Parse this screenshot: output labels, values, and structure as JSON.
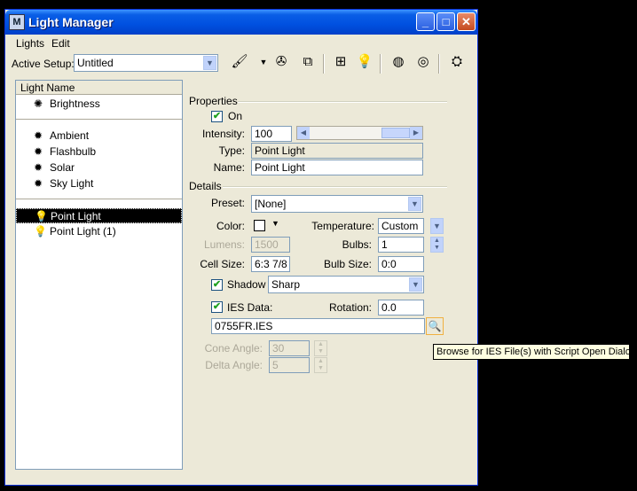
{
  "window": {
    "title": "Light Manager",
    "minimize": "_",
    "maximize": "□",
    "close": "✕"
  },
  "menu": [
    "Lights",
    "Edit"
  ],
  "toolbar": {
    "active_setup_label": "Active Setup:",
    "active_setup_value": "Untitled"
  },
  "light_list": {
    "header": "Light Name",
    "groups": [
      [
        {
          "name": "Brightness",
          "icon": "brightness-icon"
        }
      ],
      [
        {
          "name": "Ambient",
          "icon": "ambient-icon"
        },
        {
          "name": "Flashbulb",
          "icon": "flashbulb-icon"
        },
        {
          "name": "Solar",
          "icon": "solar-icon"
        },
        {
          "name": "Sky Light",
          "icon": "sky-light-icon"
        }
      ],
      [
        {
          "name": "Point Light",
          "icon": "bulb-icon",
          "selected": true
        },
        {
          "name": "Point Light (1)",
          "icon": "bulb-icon"
        }
      ]
    ]
  },
  "properties": {
    "section": "Properties",
    "on_label": "On",
    "on_checked": true,
    "intensity_label": "Intensity:",
    "intensity_value": "100",
    "type_label": "Type:",
    "type_value": "Point Light",
    "name_label": "Name:",
    "name_value": "Point Light"
  },
  "details": {
    "section": "Details",
    "preset_label": "Preset:",
    "preset_value": "[None]",
    "color_label": "Color:",
    "temperature_label": "Temperature:",
    "temperature_value": "Custom",
    "lumens_label": "Lumens:",
    "lumens_value": "1500",
    "bulbs_label": "Bulbs:",
    "bulbs_value": "1",
    "cell_size_label": "Cell Size:",
    "cell_size_value": "6:3 7/8",
    "bulb_size_label": "Bulb Size:",
    "bulb_size_value": "0:0",
    "shadow_label": "Shadow",
    "shadow_checked": true,
    "shadow_value": "Sharp",
    "ies_label": "IES Data:",
    "ies_checked": true,
    "rotation_label": "Rotation:",
    "rotation_value": "0.0",
    "ies_file": "0755FR.IES",
    "cone_angle_label": "Cone Angle:",
    "cone_angle_value": "30",
    "delta_angle_label": "Delta Angle:",
    "delta_angle_value": "5"
  },
  "tooltip": "Browse for IES File(s) with Script Open Dialog",
  "colors": {
    "titlebar": "#0050e0",
    "dialog": "#ece9d8",
    "selection": "#000000"
  }
}
